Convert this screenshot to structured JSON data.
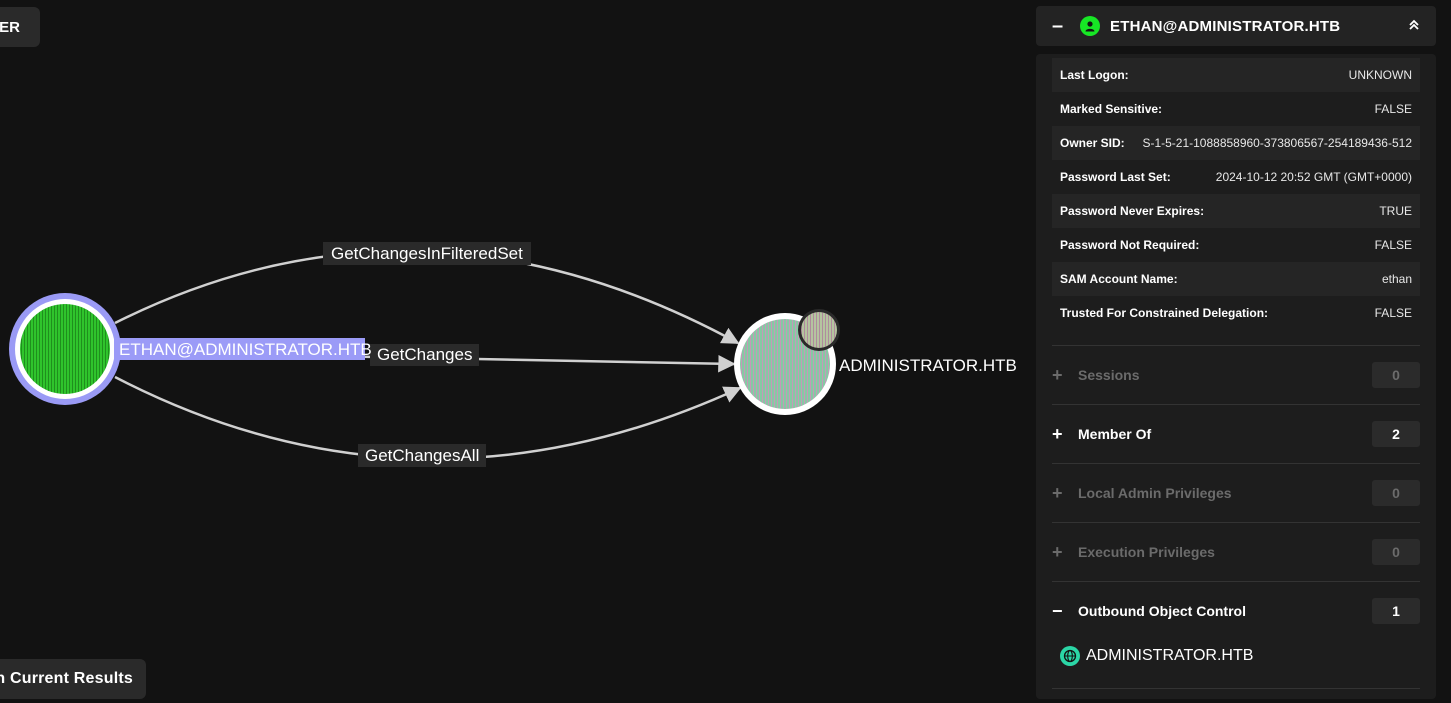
{
  "buttons": {
    "top_left": "HER",
    "bottom_left": "ch Current Results"
  },
  "graph": {
    "source_node": "ETHAN@ADMINISTRATOR.HTB",
    "target_node": "ADMINISTRATOR.HTB",
    "edges": [
      "GetChangesInFilteredSet",
      "GetChanges",
      "GetChangesAll"
    ],
    "colors": {
      "user_node": "#29c22b",
      "user_ring": "#9a9af5",
      "domain_node": "#7fc9a0",
      "edge": "#d0d0d0",
      "label_bg": "#2a2a2a",
      "source_label_bg": "#9b9bf7"
    }
  },
  "panel": {
    "title": "ETHAN@ADMINISTRATOR.HTB",
    "icon": "user-icon",
    "properties": [
      {
        "key": "Last Logon:",
        "value": "UNKNOWN"
      },
      {
        "key": "Marked Sensitive:",
        "value": "FALSE"
      },
      {
        "key": "Owner SID:",
        "value": "S-1-5-21-1088858960-373806567-254189436-512"
      },
      {
        "key": "Password Last Set:",
        "value": "2024-10-12 20:52 GMT (GMT+0000)"
      },
      {
        "key": "Password Never Expires:",
        "value": "TRUE"
      },
      {
        "key": "Password Not Required:",
        "value": "FALSE"
      },
      {
        "key": "SAM Account Name:",
        "value": "ethan"
      },
      {
        "key": "Trusted For Constrained Delegation:",
        "value": "FALSE"
      }
    ],
    "sections": [
      {
        "sign": "+",
        "label": "Sessions",
        "count": "0",
        "enabled": false
      },
      {
        "sign": "+",
        "label": "Member Of",
        "count": "2",
        "enabled": true
      },
      {
        "sign": "+",
        "label": "Local Admin Privileges",
        "count": "0",
        "enabled": false
      },
      {
        "sign": "+",
        "label": "Execution Privileges",
        "count": "0",
        "enabled": false
      },
      {
        "sign": "−",
        "label": "Outbound Object Control",
        "count": "1",
        "enabled": true
      }
    ],
    "outbound_items": [
      {
        "icon": "globe-icon",
        "label": "ADMINISTRATOR.HTB"
      }
    ]
  }
}
